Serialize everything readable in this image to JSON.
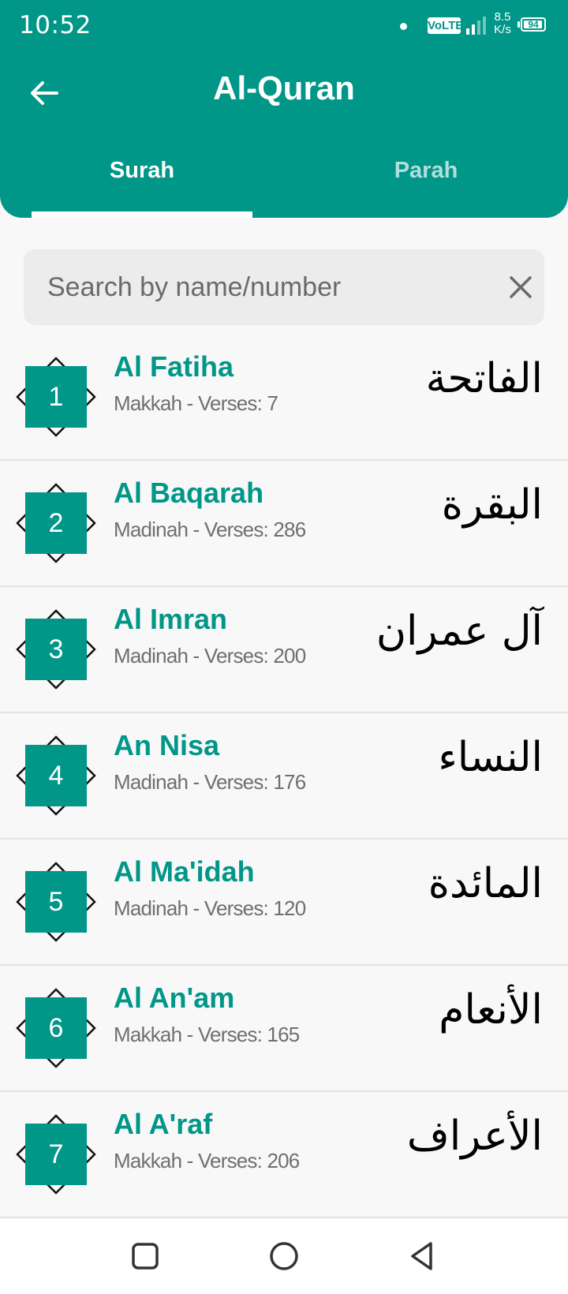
{
  "status_bar": {
    "time": "10:52",
    "network": "VoLTE",
    "speed_value": "8.5",
    "speed_unit": "K/s",
    "battery": "94"
  },
  "header": {
    "title": "Al-Quran",
    "back_icon": "arrow-left-icon"
  },
  "tabs": [
    {
      "label": "Surah",
      "active": true
    },
    {
      "label": "Parah",
      "active": false
    }
  ],
  "search": {
    "placeholder": "Search by name/number",
    "value": "",
    "clear_icon": "close-icon"
  },
  "surahs": [
    {
      "number": "1",
      "name": "Al Fatiha",
      "meta": "Makkah - Verses: 7",
      "arabic": "الفاتحة"
    },
    {
      "number": "2",
      "name": "Al Baqarah",
      "meta": "Madinah - Verses: 286",
      "arabic": "البقرة"
    },
    {
      "number": "3",
      "name": "Al Imran",
      "meta": "Madinah - Verses: 200",
      "arabic": "آل عمران"
    },
    {
      "number": "4",
      "name": "An Nisa",
      "meta": "Madinah - Verses: 176",
      "arabic": "النساء"
    },
    {
      "number": "5",
      "name": "Al Ma'idah",
      "meta": "Madinah - Verses: 120",
      "arabic": "المائدة"
    },
    {
      "number": "6",
      "name": "Al An'am",
      "meta": "Makkah - Verses: 165",
      "arabic": "الأنعام"
    },
    {
      "number": "7",
      "name": "Al A'raf",
      "meta": "Makkah - Verses: 206",
      "arabic": "الأعراف"
    }
  ],
  "nav_bar": {
    "icons": [
      "recents-square-icon",
      "home-circle-icon",
      "back-triangle-icon"
    ]
  },
  "colors": {
    "primary": "#009688",
    "tab_inactive": "#b2dfdb",
    "background": "#f8f8f8"
  }
}
